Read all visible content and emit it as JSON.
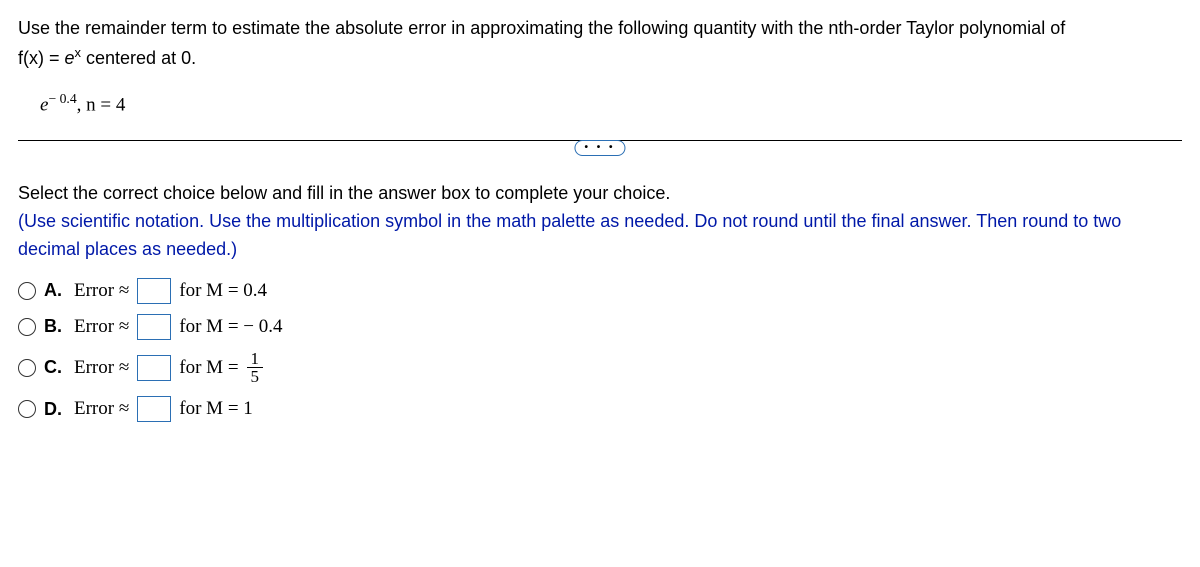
{
  "problem": {
    "line1": "Use the remainder term to estimate the absolute error in approximating the following quantity with the nth-order Taylor polynomial of",
    "line2_prefix": "f(x) = ",
    "line2_e": "e",
    "line2_exp": "x",
    "line2_suffix": " centered at 0."
  },
  "given": {
    "e": "e",
    "exp": "− 0.4",
    "n": ", n = 4"
  },
  "ellipsis": "• • •",
  "instructions": {
    "line1": "Select the correct choice below and fill in the answer box to complete your choice.",
    "line2": "(Use scientific notation. Use the multiplication symbol in the math palette as needed. Do not round until the final answer. Then round to two decimal places as needed.)"
  },
  "options": {
    "a": {
      "label": "A.",
      "error": "Error ≈",
      "for_m": "for M = 0.4"
    },
    "b": {
      "label": "B.",
      "error": "Error ≈",
      "for_m": "for M =  − 0.4"
    },
    "c": {
      "label": "C.",
      "error": "Error ≈",
      "for_m_prefix": "for M = ",
      "num": "1",
      "den": "5"
    },
    "d": {
      "label": "D.",
      "error": "Error ≈",
      "for_m": "for M = 1"
    }
  }
}
